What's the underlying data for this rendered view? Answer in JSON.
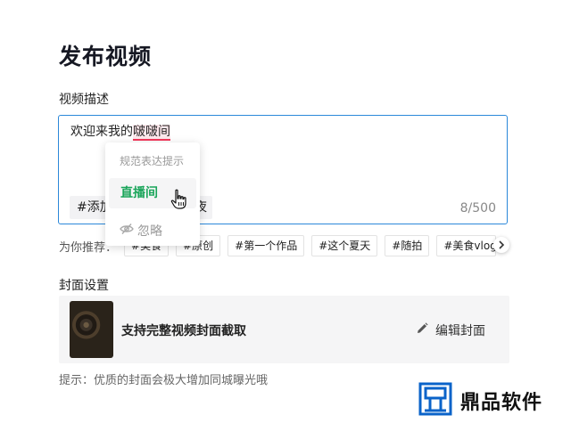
{
  "page": {
    "title": "发布视频"
  },
  "description": {
    "label": "视频描述",
    "text_prefix": "欢迎来我的",
    "text_highlight": "啵啵间",
    "tag_add_label": "#添加",
    "tag_tail_label": "夜",
    "counter": "8/500"
  },
  "suggest_popup": {
    "hint": "规范表达提示",
    "option": "直播间",
    "ignore_label": "忽略"
  },
  "recommend": {
    "label": "为你推荐：",
    "tags": [
      "#美食",
      "#原创",
      "#第一个作品",
      "#这个夏天",
      "#随拍",
      "#美食vlog"
    ]
  },
  "cover": {
    "label": "封面设置",
    "title": "支持完整视频封面截取",
    "edit_label": "编辑封面",
    "hint": "提示：优质的封面会极大增加同城曝光哦"
  },
  "watermark": {
    "text": "鼎品软件"
  },
  "colors": {
    "accent_blue": "#2b88d9",
    "suggest_green": "#1aa55a",
    "highlight_red": "#f2385a"
  }
}
